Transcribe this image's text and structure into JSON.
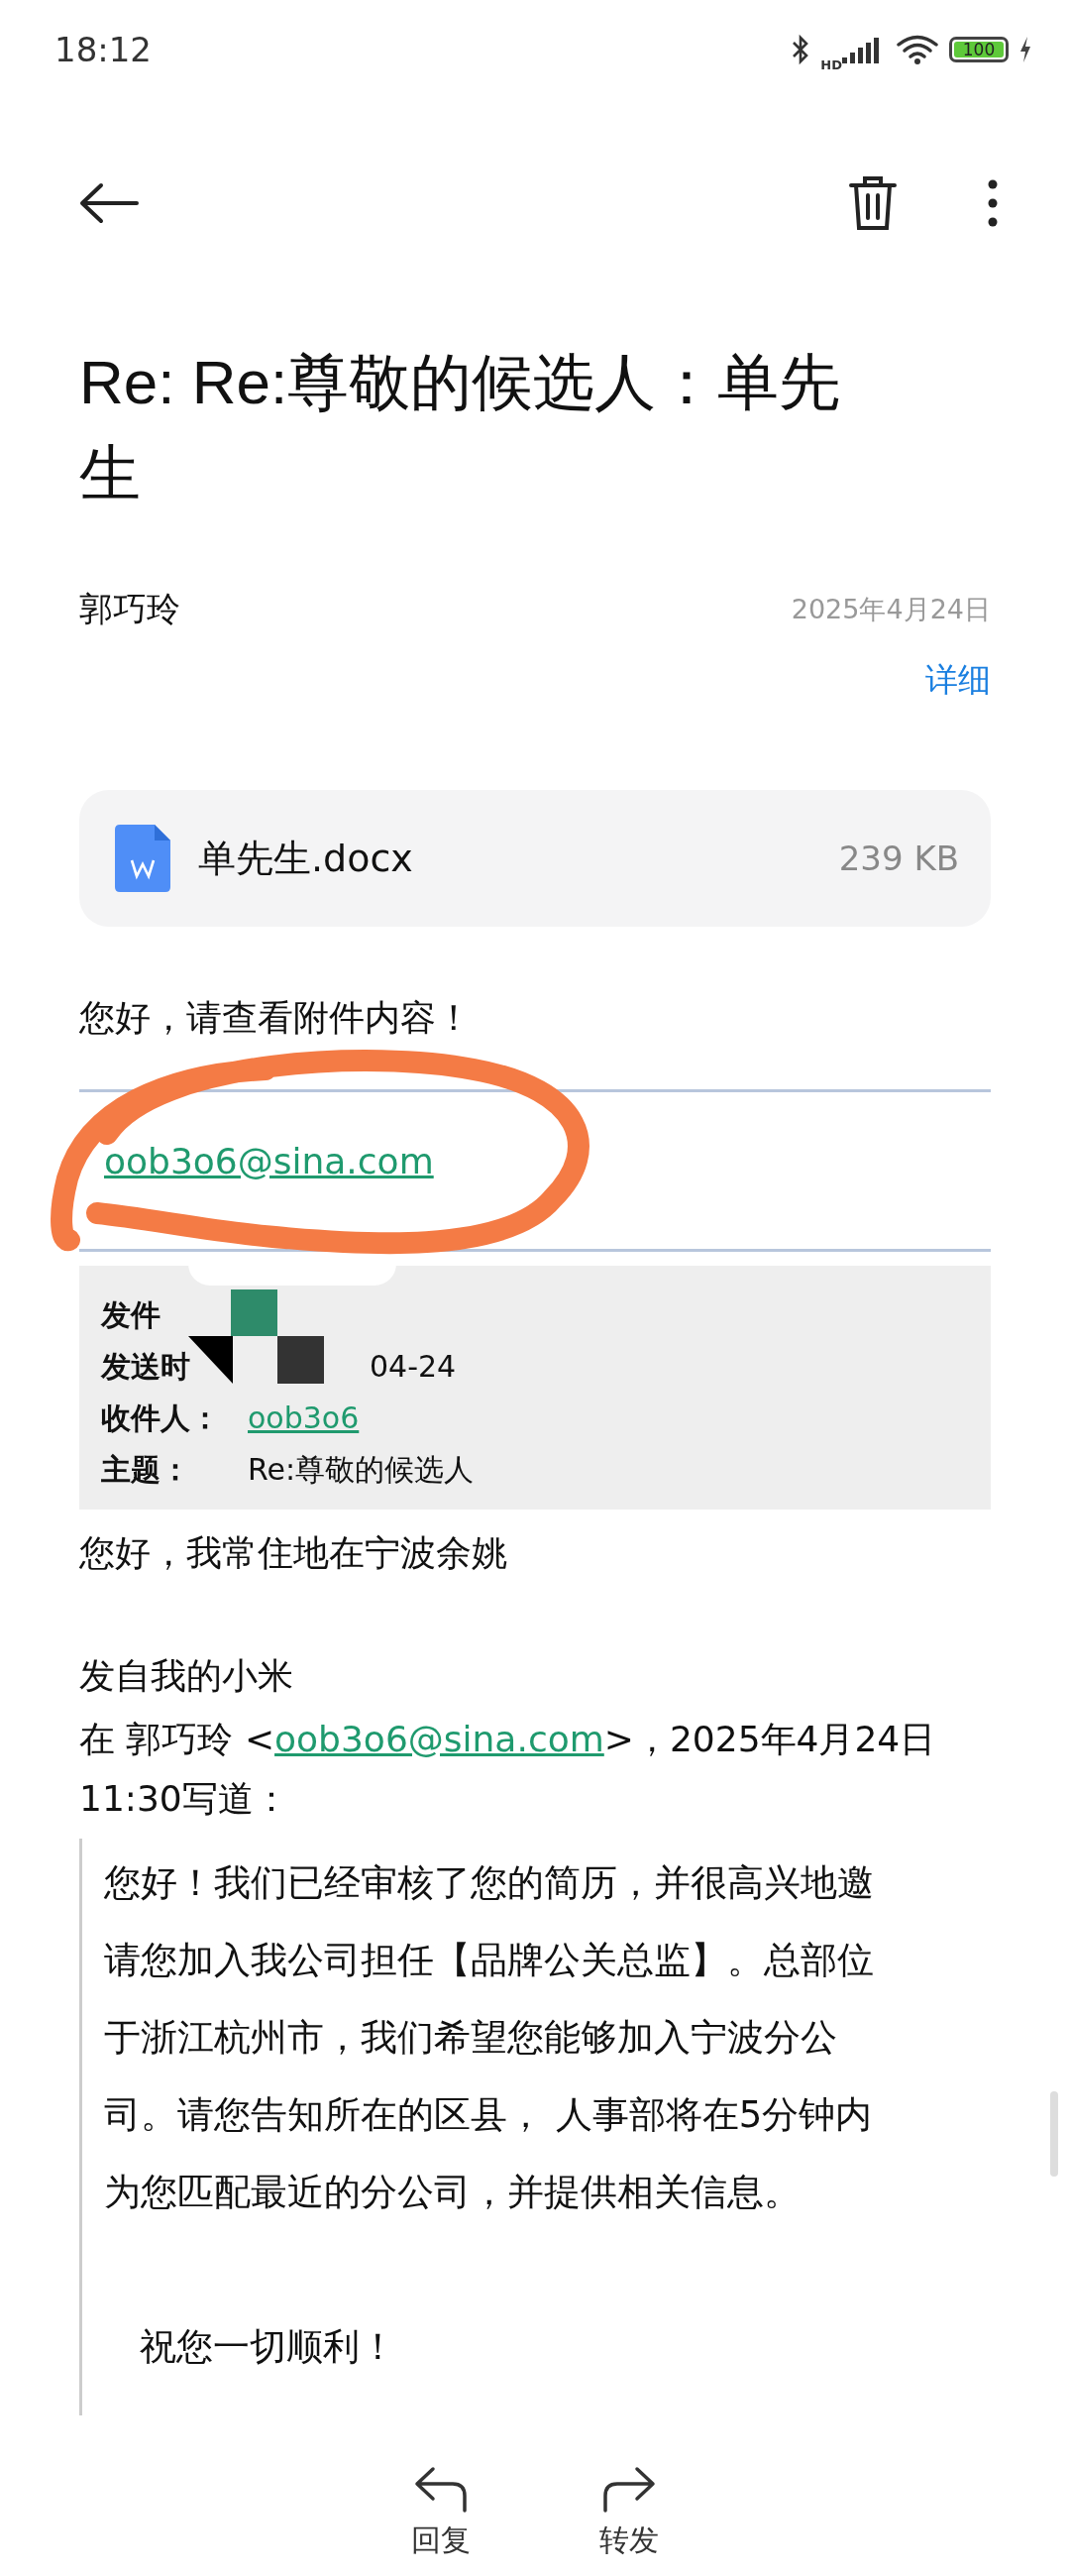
{
  "status_bar": {
    "time": "18:12",
    "battery": "100",
    "network": "HD"
  },
  "title": "Re: Re:尊敬的候选人：单先生",
  "sender": {
    "name": "郭巧玲",
    "date": "2025年4月24日",
    "details": "详细"
  },
  "attachment": {
    "name": "单先生.docx",
    "size": "239 KB"
  },
  "greeting": "您好，请查看附件内容！",
  "email_link": "oob3o6@sina.com",
  "quoted_header": [
    {
      "label": "发件",
      "kind": "redacted"
    },
    {
      "label": "发送时",
      "value": "04-24",
      "kind": "redacted"
    },
    {
      "label": "收件人：",
      "value": "oob3o6",
      "kind": "link"
    },
    {
      "label": "主题：",
      "value": "Re:尊敬的候选人",
      "kind": "text"
    }
  ],
  "reply_text": "您好，我常住地在宁波余姚",
  "signature": "发自我的小米",
  "quote_intro": {
    "prefix": "在 郭巧玲 <",
    "email": "oob3o6@sina.com",
    "suffix": ">，2025年4月24日 11:30写道："
  },
  "quote_lines": [
    "您好！我们已经审核了您的简历，并很高兴地邀",
    "请您加入我公司担任【品牌公关总监】。总部位",
    "于浙江杭州市，我们希望您能够加入宁波分公",
    "司。请您告知所在的区县， 人事部将在5分钟内",
    "为您匹配最近的分公司，并提供相关信息。"
  ],
  "closing": "祝您一切顺利！",
  "actions": [
    {
      "label": "回复",
      "kind": "reply"
    },
    {
      "label": "转发",
      "kind": "forward"
    }
  ]
}
